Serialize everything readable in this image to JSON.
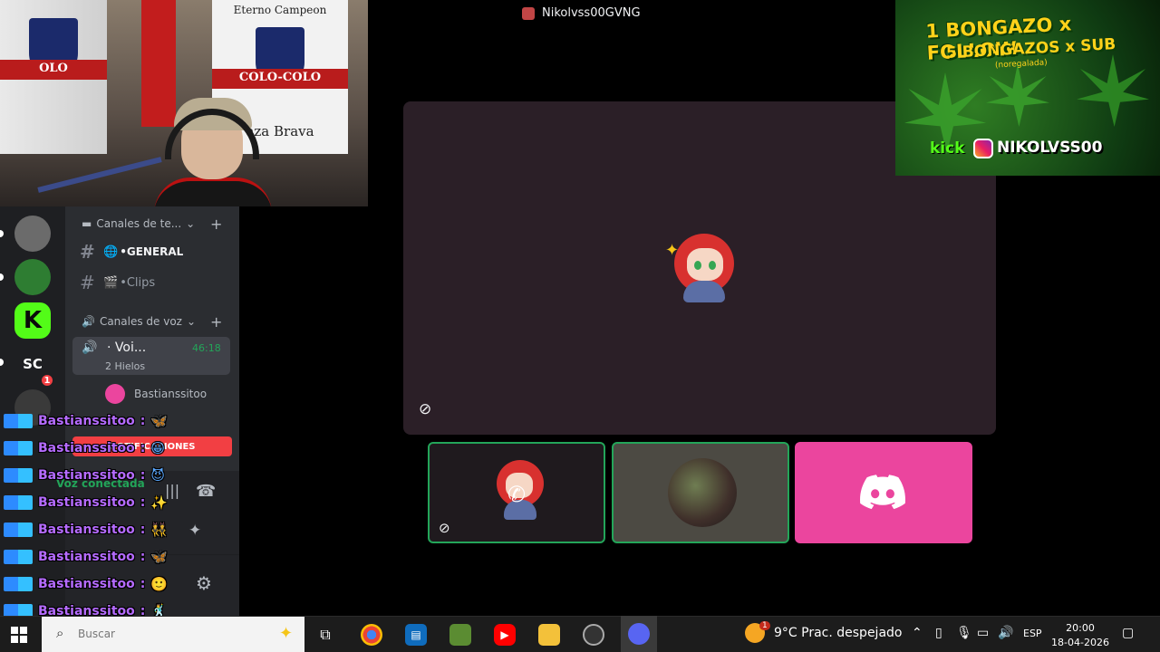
{
  "window": {
    "title": "Nikolvss00GVNG"
  },
  "webcam": {
    "flag_top": "Eterno Campeon",
    "flag_text": "COLO-COLO",
    "flag_bottom": "aza Brava",
    "flag_left_text": "OLO"
  },
  "banner": {
    "line1": "1 BONGAZO x FOLLOW",
    "line2": "5 BONGAZOS x SUB",
    "line3": "(noregalada)",
    "kick": "kick",
    "handle": "NIKOLVSS00"
  },
  "servers": [
    {
      "name": "server-1"
    },
    {
      "name": "server-2"
    },
    {
      "label": "K"
    },
    {
      "label": "SC",
      "badge": "1"
    }
  ],
  "channels": {
    "text_category": "Canales de te...",
    "text_channels": [
      {
        "emoji": "🌐",
        "label": "•GENERAL",
        "active": true
      },
      {
        "emoji": "🎬",
        "label": "•Clips",
        "active": false
      }
    ],
    "voice_category": "Canales de voz",
    "voice_channel": {
      "label": "· Voi...",
      "time": "46:18",
      "sub": "2 Hielos"
    },
    "voice_user": "Bastianssitoo"
  },
  "notification_bar": {
    "label": "NOTIFICACIONES"
  },
  "voice_status": {
    "label": "Voz conectada"
  },
  "chat": {
    "username": "Bastianssitoo",
    "lines": [
      {
        "user": "Bastianssitoo",
        "sep": ":",
        "emote": "🦋"
      },
      {
        "user": "Bastianssitoo",
        "sep": ":",
        "emote": "😀"
      },
      {
        "user": "Bastianssitoo",
        "sep": ":",
        "emote": "😈"
      },
      {
        "user": "Bastianssitoo",
        "sep": ":",
        "emote": "✨"
      },
      {
        "user": "Bastianssitoo",
        "sep": ":",
        "emote": "👯"
      },
      {
        "user": "Bastianssitoo",
        "sep": ":",
        "emote": "🦋"
      },
      {
        "user": "Bastianssitoo",
        "sep": ":",
        "emote": "🙂"
      },
      {
        "user": "Bastianssitoo",
        "sep": ":",
        "emote": "🕺"
      },
      {
        "user": "Bastianssitoo",
        "sep": ":",
        "emote": "✨"
      }
    ]
  },
  "taskbar": {
    "search_placeholder": "Buscar",
    "weather": "9°C  Prac. despejado",
    "weather_badge": "1",
    "lang": "ESP",
    "time": "20:00",
    "date": "18-04-2026"
  },
  "colors": {
    "discord_bg": "#2b2d31",
    "server_rail": "#1e1f22",
    "speaking_green": "#23a559",
    "discord_pink": "#eb459e",
    "chat_purple": "#b56bff"
  }
}
